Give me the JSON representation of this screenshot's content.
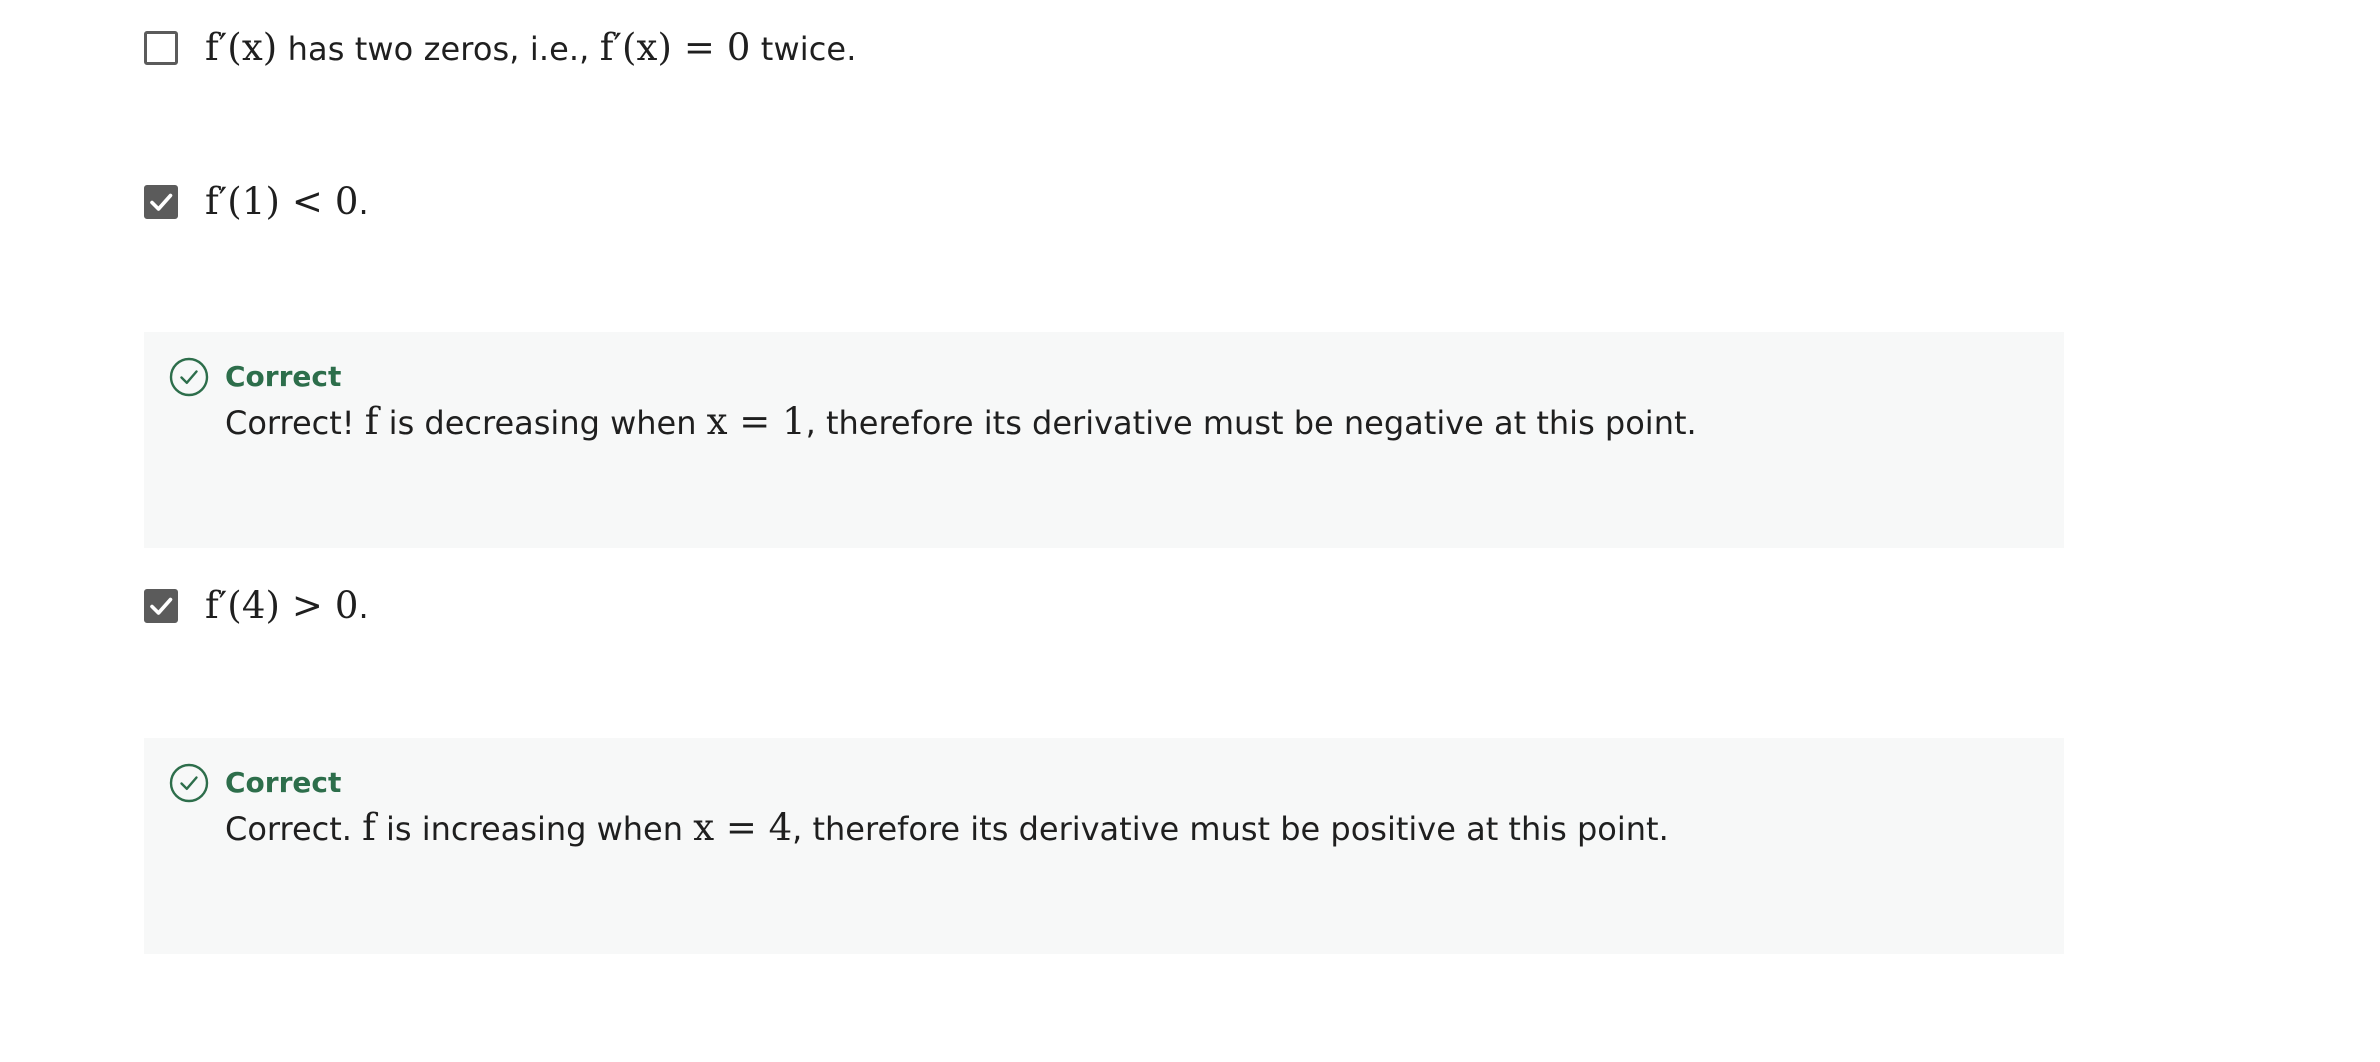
{
  "options": [
    {
      "checked": false,
      "math_a": "f′(x)",
      "text_a": " has two zeros, i.e., ",
      "math_b": "f′(x) = 0",
      "text_b": " twice."
    },
    {
      "checked": true,
      "math_a": "f′(1) < 0",
      "text_a": "."
    },
    {
      "checked": true,
      "math_a": "f′(4) > 0",
      "text_a": "."
    }
  ],
  "feedback": [
    {
      "title": "Correct",
      "prefix": "Correct! ",
      "math_a": "f",
      "middle": " is decreasing when ",
      "math_b": "x = 1",
      "suffix": ", therefore its derivative must be negative at this point."
    },
    {
      "title": "Correct",
      "prefix": "Correct. ",
      "math_a": "f",
      "middle": " is increasing when ",
      "math_b": "x = 4",
      "suffix": ", therefore its derivative must be positive at this point."
    }
  ],
  "colors": {
    "checkbox": "#5b5b5b",
    "feedback_background": "#f7f8f8",
    "correct_green": "#2d6e4b"
  },
  "icons": {
    "checkmark": "checkmark-icon",
    "correct": "correct-circle-check-icon"
  }
}
